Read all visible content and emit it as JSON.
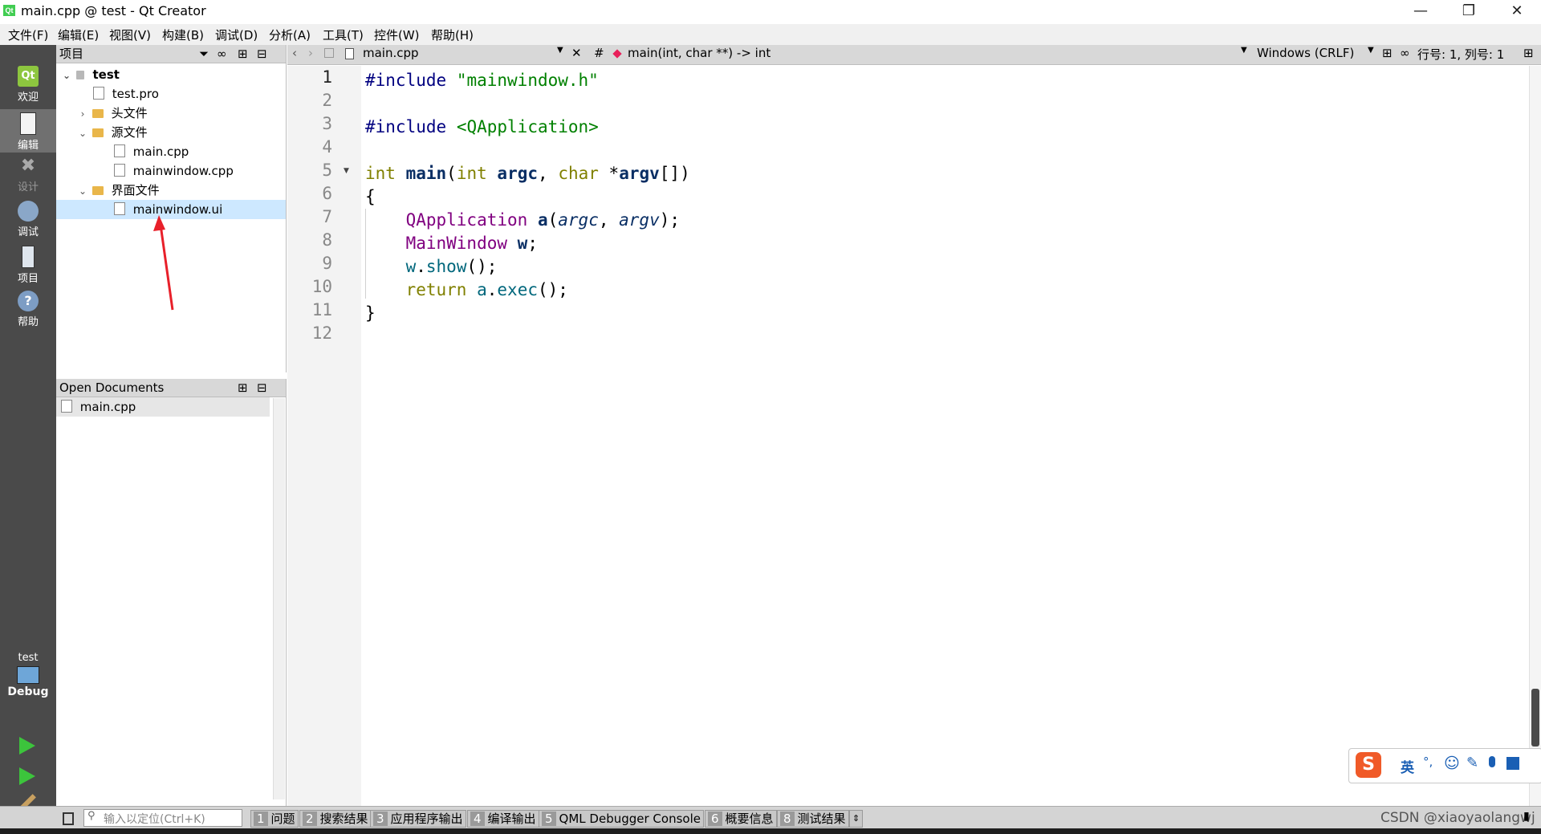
{
  "window": {
    "title": "main.cpp @ test - Qt Creator",
    "app_icon": "Qt"
  },
  "menubar": [
    "文件(F)",
    "编辑(E)",
    "视图(V)",
    "构建(B)",
    "调试(D)",
    "分析(A)",
    "工具(T)",
    "控件(W)",
    "帮助(H)"
  ],
  "modes": [
    {
      "label": "欢迎",
      "icon": "qt-logo-icon"
    },
    {
      "label": "编辑",
      "icon": "edit-doc-icon"
    },
    {
      "label": "设计",
      "icon": "design-tools-icon"
    },
    {
      "label": "调试",
      "icon": "debug-bug-icon"
    },
    {
      "label": "项目",
      "icon": "project-wrench-icon"
    },
    {
      "label": "帮助",
      "icon": "help-icon"
    }
  ],
  "kit": {
    "project": "test",
    "config": "Debug"
  },
  "projects_pane": {
    "header": "项目",
    "tree": [
      {
        "label": "test",
        "level": 0,
        "type": "project",
        "expanded": true
      },
      {
        "label": "test.pro",
        "level": 1,
        "type": "file"
      },
      {
        "label": "头文件",
        "level": 1,
        "type": "folder",
        "expanded": false
      },
      {
        "label": "源文件",
        "level": 1,
        "type": "folder",
        "expanded": true
      },
      {
        "label": "main.cpp",
        "level": 2,
        "type": "file"
      },
      {
        "label": "mainwindow.cpp",
        "level": 2,
        "type": "file"
      },
      {
        "label": "界面文件",
        "level": 1,
        "type": "folder",
        "expanded": true
      },
      {
        "label": "mainwindow.ui",
        "level": 2,
        "type": "file",
        "selected": true
      }
    ]
  },
  "open_documents": {
    "header": "Open Documents",
    "items": [
      "main.cpp"
    ]
  },
  "editor": {
    "file_tab": "main.cpp",
    "hash": "#",
    "symbol": "main(int, char **) -> int",
    "line_ending": "Windows (CRLF)",
    "position": "行号: 1, 列号: 1",
    "line_numbers": [
      "1",
      "2",
      "3",
      "4",
      "5",
      "6",
      "7",
      "8",
      "9",
      "10",
      "11",
      "12"
    ],
    "code": {
      "l1_directive": "#include",
      "l1_file": "\"mainwindow.h\"",
      "l3_directive": "#include",
      "l3_file": "<QApplication>",
      "l5_int": "int",
      "l5_main": "main",
      "l5_open": "(",
      "l5_int2": "int",
      "l5_argc": "argc",
      "l5_comma": ",",
      "l5_char": "char",
      "l5_star": "*",
      "l5_argv": "argv",
      "l5_close": "[])",
      "l6": "{",
      "l7_type": "QApplication",
      "l7_a": "a",
      "l7_open": "(",
      "l7_argc": "argc",
      "l7_comma": ", ",
      "l7_argv": "argv",
      "l7_close": ");",
      "l8_type": "MainWindow",
      "l8_w": "w",
      "l8_semi": ";",
      "l9_w": "w",
      "l9_dot": ".",
      "l9_show": "show",
      "l9_rest": "();",
      "l10_return": "return",
      "l10_a": "a",
      "l10_dot": ".",
      "l10_exec": "exec",
      "l10_rest": "();",
      "l11": "}"
    }
  },
  "statusbar": {
    "locator_placeholder": "输入以定位(Ctrl+K)",
    "tabs": [
      {
        "num": "1",
        "label": "问题"
      },
      {
        "num": "2",
        "label": "搜索结果"
      },
      {
        "num": "3",
        "label": "应用程序输出"
      },
      {
        "num": "4",
        "label": "编译输出"
      },
      {
        "num": "5",
        "label": "QML Debugger Console"
      },
      {
        "num": "6",
        "label": "概要信息"
      },
      {
        "num": "8",
        "label": "测试结果"
      }
    ],
    "watermark": "CSDN @xiaoyaolangwj"
  },
  "ime": {
    "label": "英",
    "punct": "°,"
  },
  "colors": {
    "sidebar": "#4a4a4a",
    "selection": "#cde8ff",
    "annotation_arrow": "#e8202a"
  }
}
